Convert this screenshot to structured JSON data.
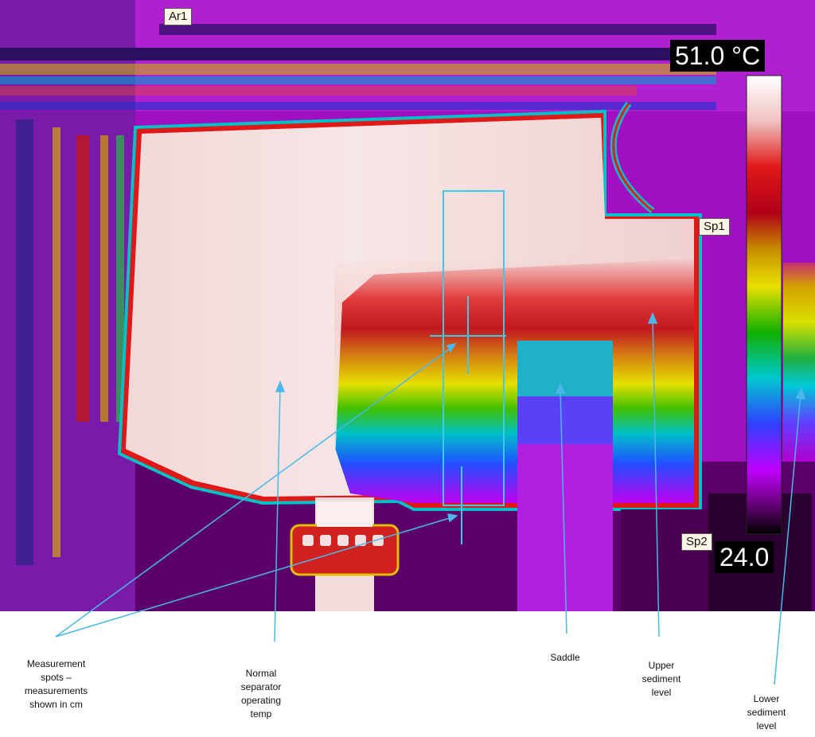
{
  "markers": {
    "area": "Ar1",
    "spot1": "Sp1",
    "spot2": "Sp2"
  },
  "temperature_scale": {
    "max_label": "51.0 °C",
    "min_label": "24.0",
    "max_value": 51.0,
    "min_value": 24.0,
    "unit": "°C",
    "palette": [
      "#ffffff",
      "#f4c8c8",
      "#e81818",
      "#b40018",
      "#d49a00",
      "#e8e000",
      "#10b000",
      "#00c8d0",
      "#2040ff",
      "#c000ff",
      "#600070",
      "#000000"
    ]
  },
  "annotations": {
    "measurement_spots": "Measurement spots – measurements shown in cm",
    "normal_temp": "Normal separator operating temp",
    "saddle": "Saddle",
    "upper_sediment": "Upper sediment level",
    "lower_sediment": "Lower sediment level"
  },
  "colors": {
    "leader_line": "#4ab8e8",
    "roi_box": "#40c8e8"
  }
}
